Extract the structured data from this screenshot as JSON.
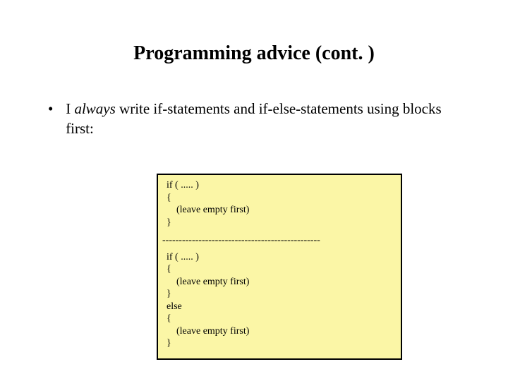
{
  "title": "Programming advice (cont. )",
  "bullet": {
    "prefix": "I ",
    "italic": "always",
    "rest": " write if-statements and if-else-statements using blocks first:"
  },
  "code": {
    "block1": {
      "l1": "if ( ..... )",
      "l2": "{",
      "l3": "    (leave empty first)",
      "l4": "}"
    },
    "divider": "------------------------------------------------",
    "block2": {
      "l1": "if ( ..... )",
      "l2": "{",
      "l3": "    (leave empty first)",
      "l4": "}",
      "l5": "else",
      "l6": "{",
      "l7": "    (leave empty first)",
      "l8": "}"
    }
  }
}
